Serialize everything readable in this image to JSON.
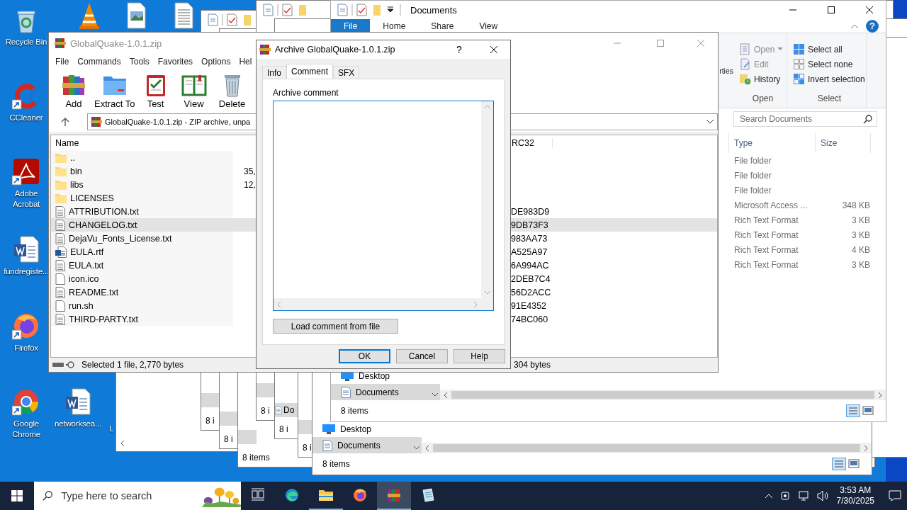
{
  "desktop": {
    "icons": [
      {
        "kind": "recycle",
        "label": "Recycle Bin"
      },
      {
        "kind": "vlc"
      },
      {
        "kind": "image"
      },
      {
        "kind": "doc"
      },
      {
        "kind": "ccleaner",
        "label": "CCleaner"
      },
      {
        "kind": "acrobat",
        "label": "Adobe Acrobat"
      },
      {
        "kind": "word",
        "label": "fundregiste..."
      },
      {
        "kind": "firefox",
        "label": "Firefox"
      },
      {
        "kind": "chrome",
        "label": "Google Chrome"
      },
      {
        "kind": "word",
        "label": "networksea..."
      },
      {
        "kind": "none",
        "label": "L"
      }
    ]
  },
  "back_windows": [
    {
      "status": "8 i"
    },
    {
      "status": "8 i"
    },
    {
      "status": "8 items"
    },
    {
      "status": "8 i"
    },
    {
      "status": "8 i",
      "nav_item": "Do"
    },
    {
      "status": "8 i"
    }
  ],
  "lower_explorer": {
    "nav_items": [
      {
        "label": "Desktop",
        "kind": "desktop",
        "selected": false
      },
      {
        "label": "Documents",
        "kind": "documents",
        "selected": true
      }
    ],
    "status": "8 items"
  },
  "explorer": {
    "title": "Documents",
    "ribbon_tabs": [
      {
        "label": "File",
        "selected": true
      },
      {
        "label": "Home",
        "selected": false
      },
      {
        "label": "Share",
        "selected": false
      },
      {
        "label": "View",
        "selected": false
      }
    ],
    "ribbon_help": "?",
    "ribbon_fragment": "rties",
    "ribbon_groups": [
      {
        "label": "Open",
        "items": [
          {
            "label": "Open",
            "kind": "open",
            "disabled": true,
            "dropdown": true
          },
          {
            "label": "Edit",
            "kind": "edit",
            "disabled": true,
            "dropdown": false
          },
          {
            "label": "History",
            "kind": "history",
            "disabled": false,
            "dropdown": false
          }
        ]
      },
      {
        "label": "Select",
        "items": [
          {
            "label": "Select all",
            "kind": "select-all",
            "disabled": false,
            "dropdown": false
          },
          {
            "label": "Select none",
            "kind": "select-none",
            "disabled": false,
            "dropdown": false
          },
          {
            "label": "Invert selection",
            "kind": "invert",
            "disabled": false,
            "dropdown": false
          }
        ]
      }
    ],
    "search": {
      "placeholder": "Search Documents"
    },
    "columns": [
      "Type",
      "Size"
    ],
    "rows": [
      {
        "type": "File folder"
      },
      {
        "type": "File folder"
      },
      {
        "type": "File folder"
      },
      {
        "type": "Microsoft Access ...",
        "size": "348 KB"
      },
      {
        "type": "Rich Text Format",
        "size": "3 KB"
      },
      {
        "type": "Rich Text Format",
        "size": "3 KB"
      },
      {
        "type": "Rich Text Format",
        "size": "4 KB"
      },
      {
        "type": "Rich Text Format",
        "size": "3 KB"
      }
    ],
    "nav_items": [
      {
        "label": "Desktop",
        "kind": "desktop",
        "selected": false
      },
      {
        "label": "Documents",
        "kind": "documents",
        "selected": true
      }
    ],
    "status": "8 items"
  },
  "winrar": {
    "title": "GlobalQuake-1.0.1.zip",
    "menu": [
      "File",
      "Commands",
      "Tools",
      "Favorites",
      "Options",
      "Hel"
    ],
    "toolbar": [
      {
        "label": "Add",
        "kind": "add"
      },
      {
        "label": "Extract To",
        "kind": "extract"
      },
      {
        "label": "Test",
        "kind": "test"
      },
      {
        "label": "View",
        "kind": "view"
      },
      {
        "label": "Delete",
        "kind": "delete"
      }
    ],
    "address": "GlobalQuake-1.0.1.zip - ZIP archive, unpa",
    "columns": [
      "Name",
      "RC32"
    ],
    "rows": [
      {
        "name": "..",
        "kind": "folder",
        "selected": false
      },
      {
        "name": "bin",
        "kind": "folder",
        "size": "35,",
        "selected": false
      },
      {
        "name": "libs",
        "kind": "folder",
        "size": "12,",
        "selected": false
      },
      {
        "name": "LICENSES",
        "kind": "folder",
        "selected": false
      },
      {
        "name": "ATTRIBUTION.txt",
        "kind": "text",
        "crc": "DE983D9",
        "selected": false
      },
      {
        "name": "CHANGELOG.txt",
        "kind": "text",
        "crc": "9DB73F3",
        "selected": true
      },
      {
        "name": "DejaVu_Fonts_License.txt",
        "kind": "text",
        "crc": "983AA73",
        "selected": false
      },
      {
        "name": "EULA.rtf",
        "kind": "word",
        "crc": "A525A97",
        "selected": false
      },
      {
        "name": "EULA.txt",
        "kind": "text",
        "crc": "6A994AC",
        "selected": false
      },
      {
        "name": "icon.ico",
        "kind": "blank",
        "crc": "2DEB7C4",
        "selected": false
      },
      {
        "name": "README.txt",
        "kind": "text",
        "crc": "56D2ACC",
        "selected": false
      },
      {
        "name": "run.sh",
        "kind": "blank",
        "crc": "91E4352",
        "selected": false
      },
      {
        "name": "THIRD-PARTY.txt",
        "kind": "text",
        "crc": "74BC060",
        "selected": false
      }
    ],
    "status": "Selected 1 file, 2,770 bytes",
    "status_2": "304 bytes"
  },
  "dialog": {
    "title": "Archive GlobalQuake-1.0.1.zip",
    "help": "?",
    "tabs": [
      {
        "label": "Info",
        "selected": false
      },
      {
        "label": "Comment",
        "selected": true
      },
      {
        "label": "SFX",
        "selected": false
      }
    ],
    "comment_label": "Archive comment",
    "load_button": "Load comment from file",
    "buttons": [
      {
        "label": "OK",
        "default": true
      },
      {
        "label": "Cancel",
        "default": false
      },
      {
        "label": "Help",
        "default": false
      }
    ]
  },
  "taskbar": {
    "search_placeholder": "Type here to search",
    "apps": [
      {
        "kind": "taskview",
        "running": false,
        "active": false
      },
      {
        "kind": "edge",
        "running": false,
        "active": false
      },
      {
        "kind": "explorer",
        "running": true,
        "active": false
      },
      {
        "kind": "firefox",
        "running": false,
        "active": false
      },
      {
        "kind": "winrar",
        "running": true,
        "active": true
      },
      {
        "kind": "notepad",
        "running": false,
        "active": false
      }
    ],
    "time": "3:53 AM",
    "date": "7/30/2025"
  }
}
